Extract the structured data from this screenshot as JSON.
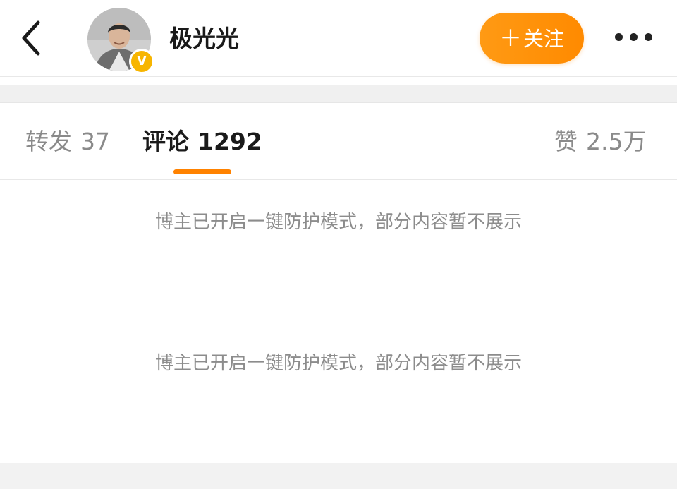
{
  "header": {
    "back_icon": "chevron-left-icon",
    "avatar_icon": "user-avatar-icon",
    "verified_icon": "verified-badge-icon",
    "verified_mark": "V",
    "username": "极光光",
    "follow_plus": "＋",
    "follow_label": "关注",
    "more_icon": "ellipsis-icon"
  },
  "tabs": [
    {
      "label": "转发",
      "count": "37",
      "active": false
    },
    {
      "label": "评论",
      "count": "1292",
      "active": true
    },
    {
      "label": "赞",
      "count": "2.5万",
      "active": false
    }
  ],
  "notices": [
    "博主已开启一键防护模式，部分内容暂不展示",
    "博主已开启一键防护模式，部分内容暂不展示"
  ],
  "colors": {
    "accent": "#ff8200",
    "follow_button": "#ff9a14",
    "verified_badge": "#f7b500",
    "muted_text": "#8c8c8c",
    "primary_text": "#1a1a1a"
  }
}
